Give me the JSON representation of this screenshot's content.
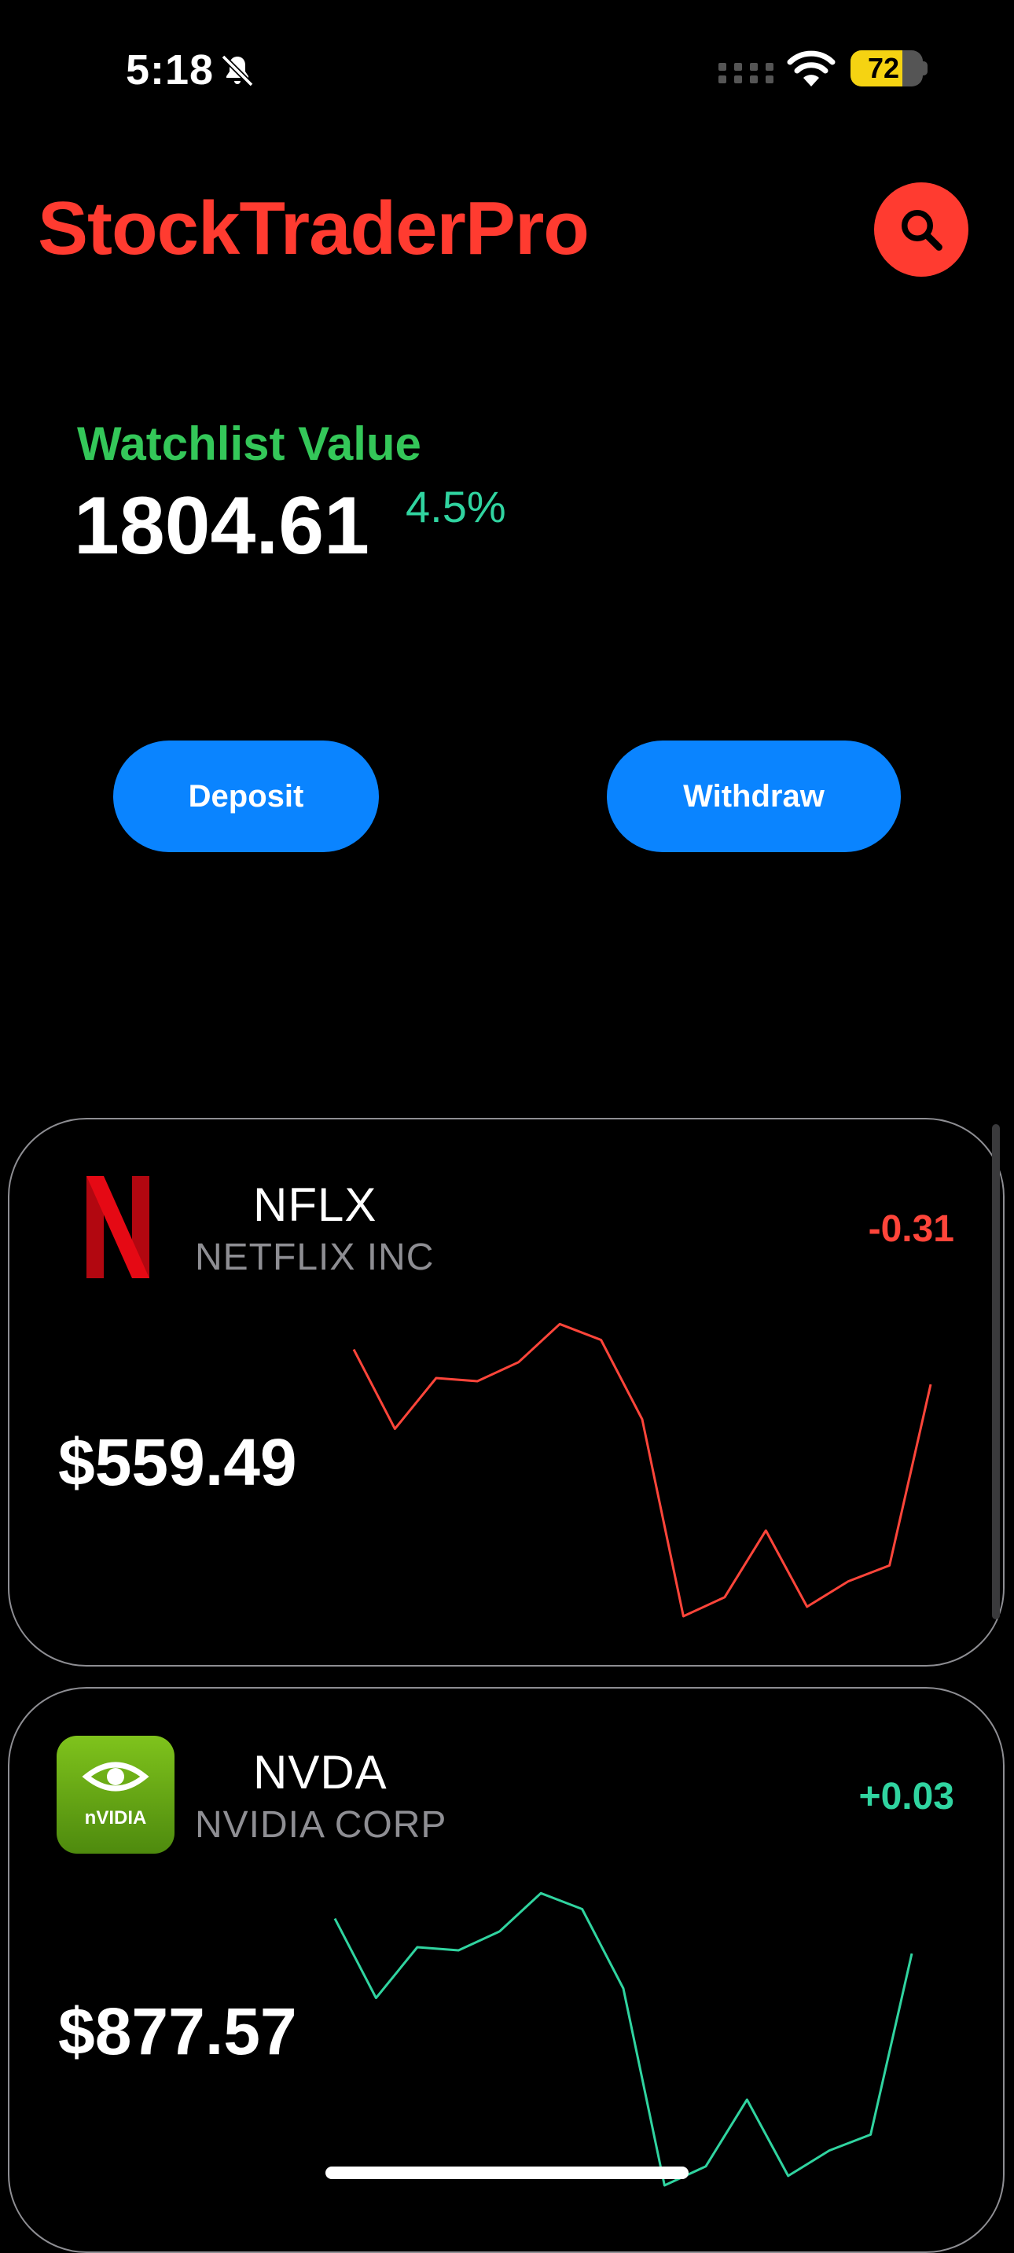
{
  "status_bar": {
    "time": "5:18",
    "battery": "72",
    "battery_level": 0.72,
    "icons": [
      "bell-slash-icon",
      "cellular-icon",
      "wifi-icon",
      "battery-icon"
    ]
  },
  "header": {
    "title": "StockTraderPro",
    "search_icon": "search-icon"
  },
  "watchlist": {
    "label": "Watchlist Value",
    "value": "1804.61",
    "change": "4.5%"
  },
  "actions": {
    "deposit": "Deposit",
    "withdraw": "Withdraw"
  },
  "stocks": [
    {
      "ticker": "NFLX",
      "company": "NETFLIX INC",
      "change": "-0.31",
      "price": "$559.49",
      "logo_icon": "netflix-logo-icon",
      "color": "#ff453a",
      "sparkline": [
        0.84,
        0.59,
        0.75,
        0.74,
        0.8,
        0.92,
        0.87,
        0.62,
        0.0,
        0.06,
        0.27,
        0.03,
        0.11,
        0.16,
        0.73
      ]
    },
    {
      "ticker": "NVDA",
      "company": "NVIDIA CORP",
      "change": "+0.03",
      "price": "$877.57",
      "logo_icon": "nvidia-logo-icon",
      "color": "#30d4a0",
      "sparkline": [
        0.84,
        0.59,
        0.75,
        0.74,
        0.8,
        0.92,
        0.87,
        0.62,
        0.0,
        0.06,
        0.27,
        0.03,
        0.11,
        0.16,
        0.73
      ]
    }
  ],
  "colors": {
    "brand": "#ff3b30",
    "accent_button": "#0a84ff",
    "positive": "#30d4a0",
    "negative": "#ff453a",
    "label_green": "#34c759"
  }
}
